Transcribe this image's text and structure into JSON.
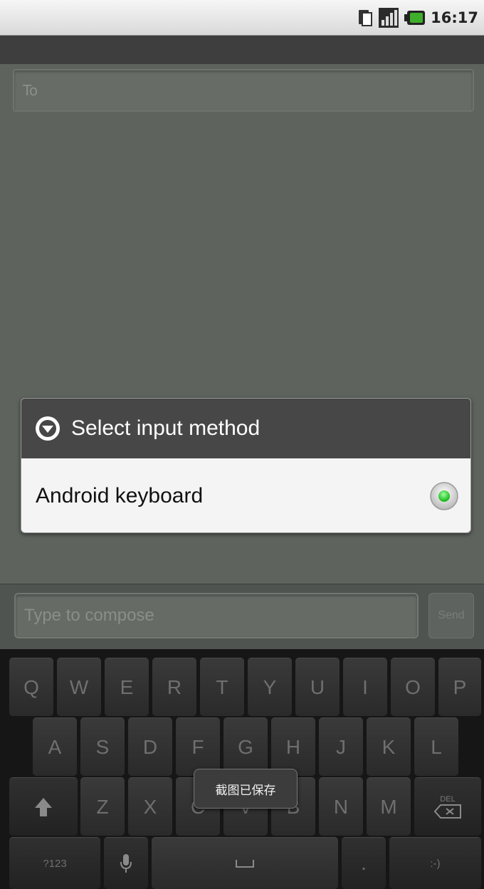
{
  "status_bar": {
    "time": "16:17",
    "icons": [
      "sim-card-icon",
      "signal-icon",
      "battery-icon"
    ]
  },
  "compose_to": {
    "placeholder": "To"
  },
  "dialog": {
    "title": "Select input method",
    "title_icon": "dropdown-circle-icon",
    "options": [
      {
        "label": "Android keyboard",
        "selected": true
      }
    ]
  },
  "compose_bar": {
    "placeholder": "Type to compose",
    "send_label": "Send"
  },
  "keyboard": {
    "row1": [
      "Q",
      "W",
      "E",
      "R",
      "T",
      "Y",
      "U",
      "I",
      "O",
      "P"
    ],
    "row2": [
      "A",
      "S",
      "D",
      "F",
      "G",
      "H",
      "J",
      "K",
      "L"
    ],
    "row3": [
      "Z",
      "X",
      "C",
      "V",
      "B",
      "N",
      "M"
    ],
    "delete_label": "DEL",
    "mode_label": "?123",
    "period_label": ".",
    "smiley_label": ":-)"
  },
  "toast": {
    "text": "截图已保存"
  },
  "colors": {
    "selected_radio": "#2fd52f",
    "dialog_title_bg": "#474747",
    "dialog_body_bg": "#f4f4f4",
    "background": "#5e635e"
  }
}
